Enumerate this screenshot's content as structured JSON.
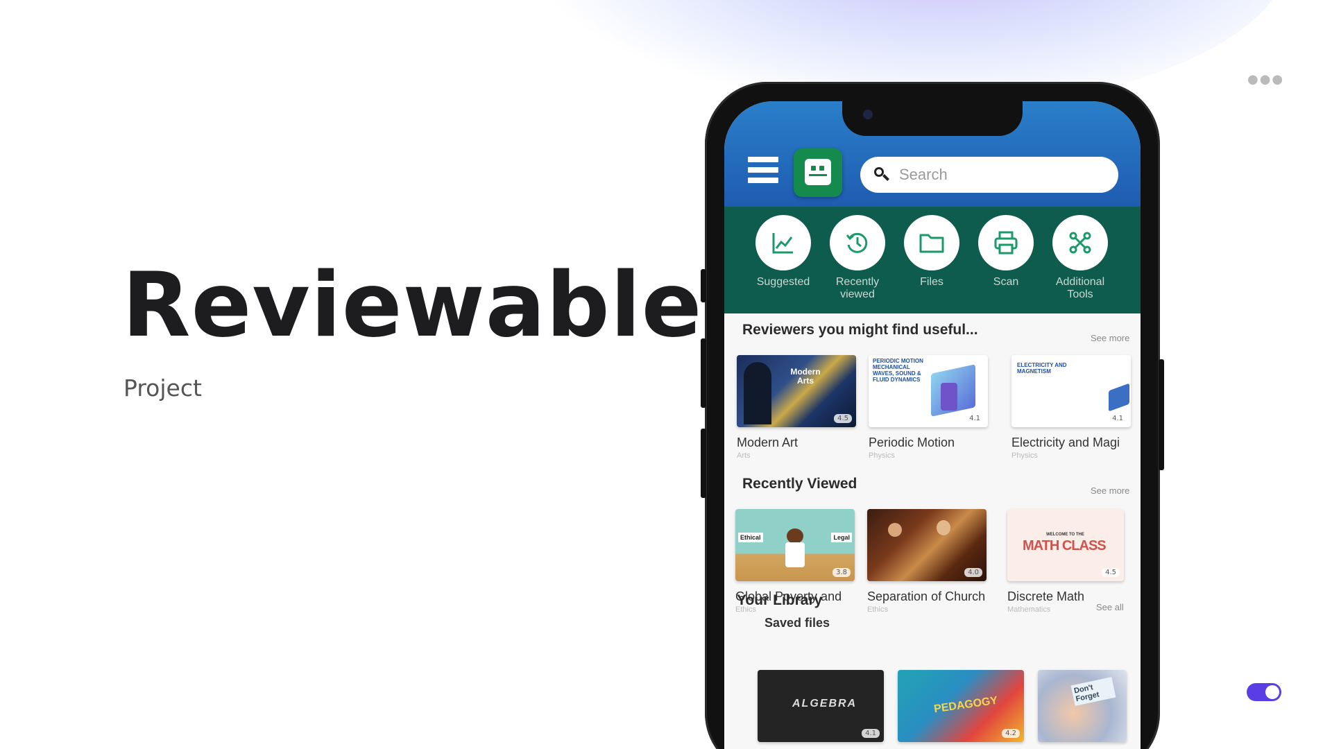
{
  "hero": {
    "title": "Reviewables",
    "subtitle": "Project"
  },
  "app": {
    "search": {
      "placeholder": "Search"
    },
    "tools": [
      {
        "label": "Suggested",
        "icon": "chart-icon"
      },
      {
        "label": "Recently viewed",
        "icon": "history-icon"
      },
      {
        "label": "Files",
        "icon": "folder-icon"
      },
      {
        "label": "Scan",
        "icon": "printer-icon"
      },
      {
        "label": "Additional Tools",
        "icon": "tools-icon"
      }
    ],
    "reviewers": {
      "title": "Reviewers you might find useful...",
      "more": "See more",
      "items": [
        {
          "title": "Modern Art",
          "category": "Arts",
          "thumb_text": "Modern Arts",
          "rating": "4.5"
        },
        {
          "title": "Periodic Motion",
          "category": "Physics",
          "thumb_text": "PERIODIC MOTION MECHANICAL WAVES, SOUND & FLUID DYNAMICS",
          "rating": "4.1"
        },
        {
          "title": "Electricity and Magi",
          "category": "Physics",
          "thumb_text": "ELECTRICITY AND MAGNETISM",
          "rating": "4.1"
        }
      ]
    },
    "recent": {
      "title": "Recently Viewed",
      "more": "See more",
      "items": [
        {
          "title": "Global Poverty and",
          "category": "Ethics",
          "thumb_left": "Ethical",
          "thumb_right": "Legal",
          "rating": "3.8"
        },
        {
          "title": "Separation of Church",
          "category": "Ethics",
          "rating": "4.0"
        },
        {
          "title": "Discrete Math",
          "category": "Mathematics",
          "thumb_small": "WELCOME TO THE",
          "thumb_text": "MATH CLASS",
          "rating": "4.5"
        }
      ]
    },
    "library": {
      "title": "Your Library",
      "more": "See all",
      "saved_title": "Saved files",
      "items": [
        {
          "thumb_text": "ALGEBRA",
          "rating": "4.1"
        },
        {
          "thumb_text": "PEDAGOGY",
          "rating": "4.2"
        },
        {
          "thumb_text": "Don't Forget"
        }
      ]
    }
  },
  "colors": {
    "accent": "#5b3de6",
    "topbar": "#1f5cb1",
    "toolbar": "#0e5c4d",
    "logo": "#148a4d"
  }
}
